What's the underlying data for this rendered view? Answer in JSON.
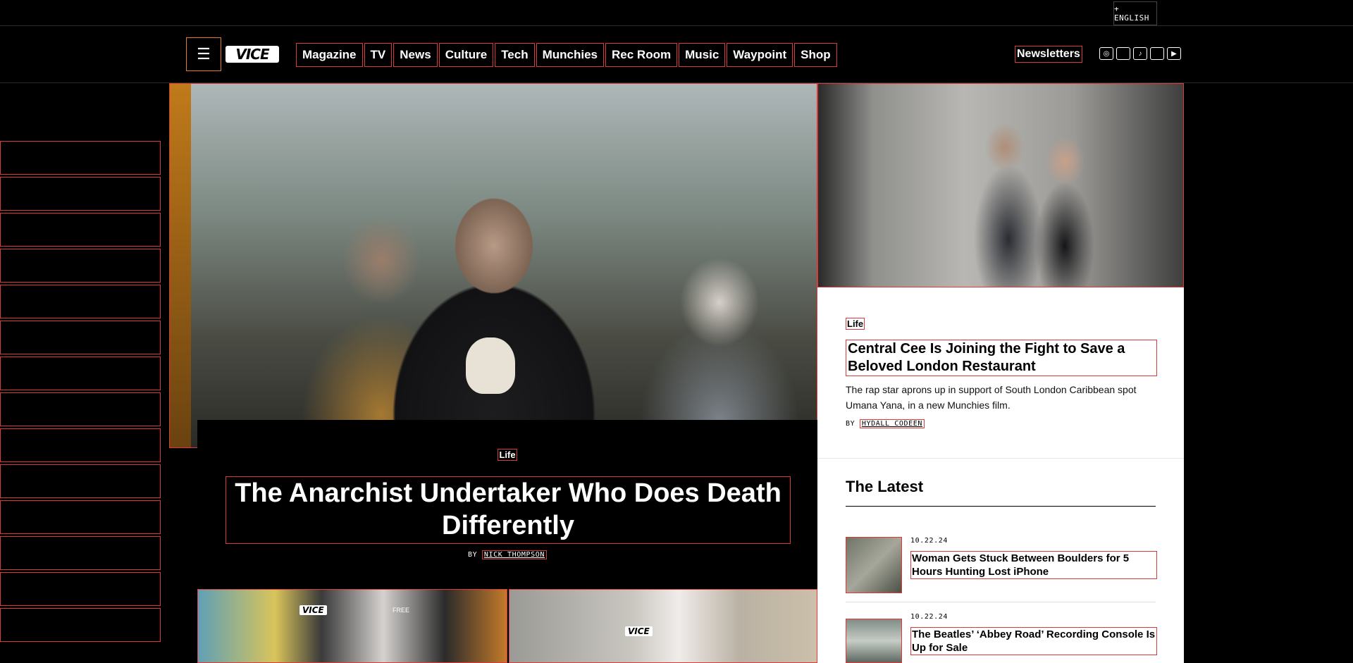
{
  "topbar": {
    "language_label": "+ ENGLISH"
  },
  "header": {
    "menu_icon": "menu-icon",
    "logo_text": "VICE",
    "nav": [
      "Magazine",
      "TV",
      "News",
      "Culture",
      "Tech",
      "Munchies",
      "Rec Room",
      "Music",
      "Waypoint",
      "Shop"
    ],
    "newsletters_label": "Newsletters",
    "socials": [
      {
        "name": "instagram-icon",
        "glyph": "◎"
      },
      {
        "name": "twitter-icon",
        "glyph": ""
      },
      {
        "name": "tiktok-icon",
        "glyph": "♪"
      },
      {
        "name": "facebook-icon",
        "glyph": ""
      },
      {
        "name": "youtube-icon",
        "glyph": "▶"
      }
    ]
  },
  "hero": {
    "kicker": "Life",
    "title": "The Anarchist Undertaker Who Does Death Differently",
    "byline_prefix": "BY",
    "author": "NICK THOMPSON"
  },
  "feature": {
    "kicker": "Life",
    "title": "Central Cee Is Joining the Fight to Save a Beloved London Restaurant",
    "description": "The rap star aprons up in support of South London Caribbean spot Umana Yana, in a new Munchies film.",
    "byline_prefix": "BY",
    "author": "HYDALL CODEEN"
  },
  "latest": {
    "heading": "The Latest",
    "items": [
      {
        "date": "10.22.24",
        "title": "Woman Gets Stuck Between Boulders for 5 Hours Hunting Lost iPhone"
      },
      {
        "date": "10.22.24",
        "title": "The Beatles’ ‘Abbey Road’ Recording Console Is Up for Sale"
      }
    ]
  },
  "thumbnails": {
    "logo_text": "VICE",
    "badge": "FREE"
  },
  "colors": {
    "accent_outline": "#d93a3a",
    "menu_outline": "#e67e22",
    "background": "#000000"
  }
}
